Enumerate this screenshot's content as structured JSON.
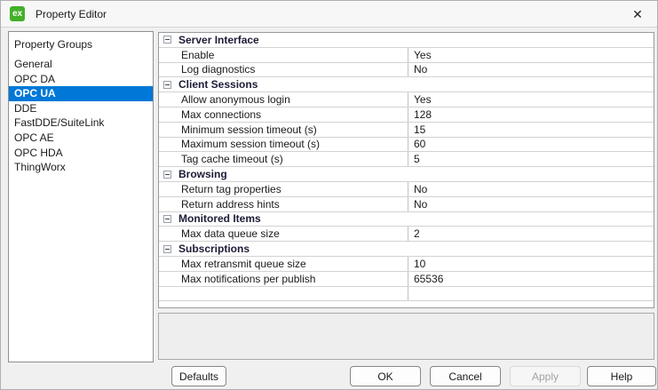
{
  "window": {
    "title": "Property Editor",
    "app_icon": {
      "text": "ex",
      "color": "#43b02a"
    },
    "close_glyph": "✕"
  },
  "sidebar": {
    "header": "Property Groups",
    "selected": "OPC UA",
    "items": [
      "General",
      "OPC DA",
      "OPC UA",
      "DDE",
      "FastDDE/SuiteLink",
      "OPC AE",
      "OPC HDA",
      "ThingWorx"
    ]
  },
  "property_grid": {
    "sections": [
      {
        "title": "Server Interface",
        "rows": [
          {
            "name": "Enable",
            "value": "Yes"
          },
          {
            "name": "Log diagnostics",
            "value": "No"
          }
        ]
      },
      {
        "title": "Client Sessions",
        "rows": [
          {
            "name": "Allow anonymous login",
            "value": "Yes"
          },
          {
            "name": "Max connections",
            "value": "128"
          },
          {
            "name": "Minimum session timeout (s)",
            "value": "15"
          },
          {
            "name": "Maximum session timeout (s)",
            "value": "60"
          },
          {
            "name": "Tag cache timeout (s)",
            "value": "5"
          }
        ]
      },
      {
        "title": "Browsing",
        "rows": [
          {
            "name": "Return tag properties",
            "value": "No"
          },
          {
            "name": "Return address hints",
            "value": "No"
          }
        ]
      },
      {
        "title": "Monitored Items",
        "rows": [
          {
            "name": "Max data queue size",
            "value": "2"
          }
        ]
      },
      {
        "title": "Subscriptions",
        "rows": [
          {
            "name": "Max retransmit queue size",
            "value": "10"
          },
          {
            "name": "Max notifications per publish",
            "value": "65536"
          }
        ]
      }
    ],
    "trailing_empty_row": true
  },
  "buttons": {
    "defaults": "Defaults",
    "ok": "OK",
    "cancel": "Cancel",
    "apply": "Apply",
    "help": "Help",
    "apply_disabled": true
  },
  "colors": {
    "selection_blue": "#0078d7",
    "icon_green": "#43b02a",
    "panel_gray": "#eeeeee"
  }
}
